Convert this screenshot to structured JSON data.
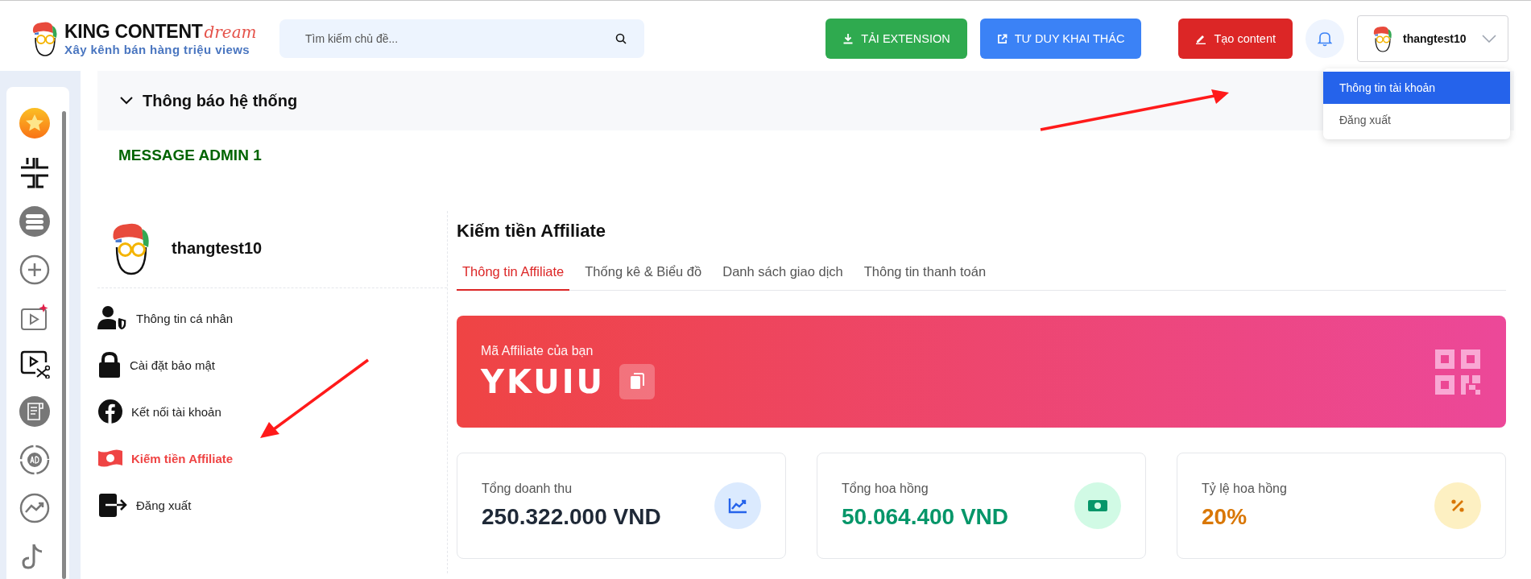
{
  "logo": {
    "title": "KING CONTENT",
    "script": "dream",
    "tagline": "Xây kênh bán hàng triệu views"
  },
  "search": {
    "placeholder": "Tìm kiếm chủ đề..."
  },
  "header_buttons": [
    {
      "label": "TẢI EXTENSION",
      "kind": "download"
    },
    {
      "label": "TƯ DUY KHAI THÁC",
      "kind": "external"
    },
    {
      "label": "Tạo content",
      "kind": "edit"
    }
  ],
  "user_menu": {
    "username": "thangtest10",
    "expanded": true,
    "items": [
      {
        "label": "Thông tin tài khoản",
        "selected": true
      },
      {
        "label": "Đăng xuất",
        "selected": false
      }
    ]
  },
  "notice": {
    "title": "Thông báo hệ thống",
    "expanded": true,
    "message": "MESSAGE ADMIN 1"
  },
  "profile": {
    "username": "thangtest10",
    "menu": [
      {
        "label": "Thông tin cá nhân",
        "selected": false
      },
      {
        "label": "Cài đặt bảo mật",
        "selected": false
      },
      {
        "label": "Kết nối tài khoản",
        "selected": false
      },
      {
        "label": "Kiếm tiền Affiliate",
        "selected": true
      },
      {
        "label": "Đăng xuất",
        "selected": false
      }
    ]
  },
  "affiliate": {
    "title": "Kiếm tiền Affiliate",
    "tabs": [
      {
        "label": "Thông tin Affiliate",
        "selected": true
      },
      {
        "label": "Thống kê & Biểu đồ",
        "selected": false
      },
      {
        "label": "Danh sách giao dịch",
        "selected": false
      },
      {
        "label": "Thông tin thanh toán",
        "selected": false
      }
    ],
    "code_label": "Mã Affiliate của bạn",
    "code": "YKUIU",
    "stats": [
      {
        "label": "Tổng doanh thu",
        "value": "250.322.000 VND",
        "kind": "revenue"
      },
      {
        "label": "Tổng hoa hồng",
        "value": "50.064.400 VND",
        "kind": "commission"
      },
      {
        "label": "Tỷ lệ hoa hồng",
        "value": "20%",
        "kind": "rate"
      }
    ]
  }
}
